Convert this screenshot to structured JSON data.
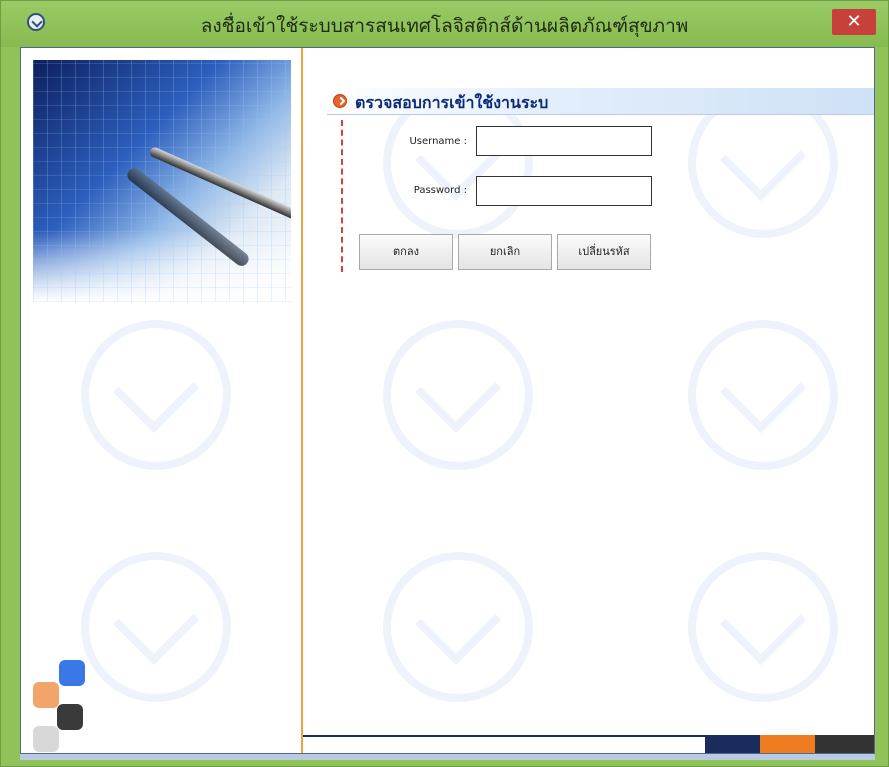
{
  "window": {
    "title": "ลงชื่อเข้าใช้ระบบสารสนเทศโลจิสติกส์ด้านผลิตภัณฑ์สุขภาพ",
    "close_label": "✕",
    "icon": "app-logo-icon",
    "frame_color": "#8fc35a"
  },
  "login": {
    "header_icon": "arrow-circle-icon",
    "header_title": "ตรวจสอบการเข้าใช้งานระบ",
    "username_label": "Username :",
    "username_value": "",
    "password_label": "Password :",
    "password_value": ""
  },
  "buttons": {
    "ok": "ตกลง",
    "cancel": "ยกเลิก",
    "change_password": "เปลี่ยนรหัส"
  },
  "colors": {
    "header_text": "#0b2a7a",
    "accent_orange": "#ee7d22",
    "accent_navy": "#1c2b5e",
    "divider": "#f0a33c"
  }
}
